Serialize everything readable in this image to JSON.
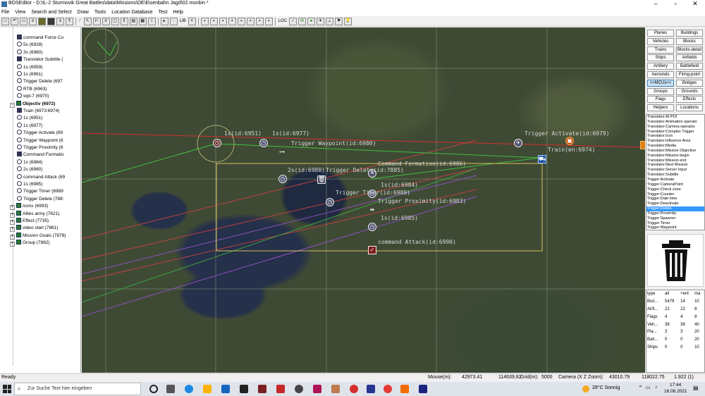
{
  "window": {
    "title": "BOSEditor - D:\\IL-2 Sturmovik Great Battles\\data\\Missions\\DE\\Eisenbahn Jagd\\02.msnbin *"
  },
  "menu": [
    "File",
    "View",
    "Search and Select",
    "Draw",
    "Tools",
    "Location Database",
    "Test",
    "Help"
  ],
  "toolbar": {
    "btn_f": "F",
    "btn_lib": "LIB",
    "btn_loc": "LOC"
  },
  "tree": {
    "items": [
      {
        "label": "command Force Co",
        "indent": 3,
        "icon": "command-icon"
      },
      {
        "label": "5s (6928)",
        "indent": 3,
        "icon": "timer-icon"
      },
      {
        "label": "3s (6960)",
        "indent": 3,
        "icon": "timer-icon"
      },
      {
        "label": "Translator Subtitle (",
        "indent": 3,
        "icon": "translator-icon"
      },
      {
        "label": "1s (6959)",
        "indent": 3,
        "icon": "timer-icon"
      },
      {
        "label": "1s (6961)",
        "indent": 3,
        "icon": "timer-icon"
      },
      {
        "label": "Trigger Delete (697",
        "indent": 3,
        "icon": "delete-icon"
      },
      {
        "label": "RTB (6963)",
        "indent": 3,
        "icon": "waypoint-icon"
      },
      {
        "label": "wpt-7 (6970)",
        "indent": 3,
        "icon": "waypoint-icon"
      },
      {
        "label": "Objectiv (6972)",
        "indent": 2,
        "icon": "folder-icon",
        "bold": true,
        "expand": "-"
      },
      {
        "label": "Train (6973:6974)",
        "indent": 3,
        "icon": "train-icon"
      },
      {
        "label": "1s (6951)",
        "indent": 3,
        "icon": "timer-icon"
      },
      {
        "label": "1s (6977)",
        "indent": 3,
        "icon": "timer-icon"
      },
      {
        "label": "Trigger Activate (69",
        "indent": 3,
        "icon": "activate-icon"
      },
      {
        "label": "Trigger Waypoint (6",
        "indent": 3,
        "icon": "waypoint-icon"
      },
      {
        "label": "Trigger Proximity (6",
        "indent": 3,
        "icon": "proximity-icon"
      },
      {
        "label": "Command Formatio",
        "indent": 3,
        "icon": "command-icon"
      },
      {
        "label": "1s (6984)",
        "indent": 3,
        "icon": "timer-icon"
      },
      {
        "label": "2s (6980)",
        "indent": 3,
        "icon": "timer-icon"
      },
      {
        "label": "command Attack (69",
        "indent": 3,
        "icon": "attack-icon"
      },
      {
        "label": "1s (6985)",
        "indent": 3,
        "icon": "timer-icon"
      },
      {
        "label": "Trigger Timer (6989",
        "indent": 3,
        "icon": "timer-icon"
      },
      {
        "label": "Trigger Delete (788:",
        "indent": 3,
        "icon": "delete-icon"
      },
      {
        "label": "Icons (6993)",
        "indent": 1,
        "icon": "folder-icon",
        "expand": "+"
      },
      {
        "label": "Allies army (7621)",
        "indent": 1,
        "icon": "folder-icon",
        "expand": "+"
      },
      {
        "label": "Effect (7735)",
        "indent": 1,
        "icon": "folder-icon",
        "expand": "+"
      },
      {
        "label": "video start (7861)",
        "indent": 1,
        "icon": "folder-icon",
        "expand": "+"
      },
      {
        "label": "Mission Goals (7878)",
        "indent": 1,
        "icon": "folder-icon",
        "expand": "+"
      },
      {
        "label": "Group (7882)",
        "indent": 1,
        "icon": "folder-icon",
        "expand": "+"
      }
    ]
  },
  "map": {
    "labels": [
      {
        "text": "1s(id:6951)"
      },
      {
        "text": "1s(id:6977)"
      },
      {
        "text": "Trigger Waypoint(id:6980)"
      },
      {
        "text": "Trigger Activate(id:6979)"
      },
      {
        "text": "Train(en:6974)"
      },
      {
        "text": "Command Formation(id:6986)"
      },
      {
        "text": "2s(id:6980)"
      },
      {
        "text": "Trigger Delete(id:7885)"
      },
      {
        "text": "1s(id:6984)"
      },
      {
        "text": "Trigger Timer(id:6989)"
      },
      {
        "text": "Trigger Proximity(id:6983)"
      },
      {
        "text": "1s(id:6985)"
      },
      {
        "text": "command Attack(id:6990)"
      }
    ]
  },
  "right_panel": {
    "buttons": [
      "Planes",
      "Buildings",
      "Vehicles",
      "Blocks",
      "Trains",
      "Blocks-detail",
      "Ships",
      "Airfields",
      "Artillery",
      "Battlefield",
      "Aerostats",
      "Firing-point",
      ">>MCUs<<",
      "Bridges",
      "Groups",
      "Grounds",
      "Flags",
      "Effects",
      "Helpers",
      "Locations"
    ],
    "selected_button": ">>MCUs<<",
    "types": [
      "Translator:AI POI",
      "Translator:Animation operato",
      "Translator:Camera operator",
      "Translator:Complex Trigger",
      "Translator:Icon",
      "Translator:Influence Area",
      "Translator:Media",
      "Translator:Mission Objective",
      "Translator:Mission begin",
      "Translator:Mission end",
      "Translator:Next Mission",
      "Translator:Server Input",
      "Translator:Subtitle",
      "Trigger:Activate",
      "Trigger:CameraPoint",
      "Trigger:Check zone",
      "Trigger:Counter",
      "Trigger:Date time",
      "Trigger:Deactivate",
      "Trigger:Delete",
      "Trigger:Proximity",
      "Trigger:Spawner",
      "Trigger:Timer",
      "Trigger:Waypoint"
    ],
    "selected_type": "Trigger:Delete",
    "stats_header": [
      "type",
      "all",
      "+ent",
      "ma"
    ],
    "stats_rows": [
      [
        "Buil...",
        "5479",
        "14",
        "10"
      ],
      [
        "Airfi...",
        "22",
        "22",
        "8"
      ],
      [
        "Flags",
        "4",
        "4",
        "8"
      ],
      [
        "Veh...",
        "38",
        "38",
        "40"
      ],
      [
        "Pla...",
        "3",
        "3",
        "20"
      ],
      [
        "Ball...",
        "0",
        "0",
        "20"
      ],
      [
        "Ships",
        "0",
        "0",
        "10"
      ]
    ]
  },
  "status": {
    "ready": "Ready",
    "mouse_label": "Mouse(m):",
    "mouse_x": "42973.41",
    "mouse_y": "114639.82",
    "grid_label": "Grid(m):",
    "grid": "5000",
    "camera_label": "Camera (X Z Zoom):",
    "camera_x": "43010.79",
    "camera_z": "118022.75",
    "zoom": "1.922 (1)"
  },
  "taskbar": {
    "search_placeholder": "Zur Suche Text hier eingeben",
    "weather": "28°C  Sonnig",
    "time": "17:44",
    "date": "16.06.2021"
  },
  "colors": {
    "accent": "#3399ff",
    "map_grid": "#8a9a80",
    "selection_box": "#d4c25a"
  }
}
